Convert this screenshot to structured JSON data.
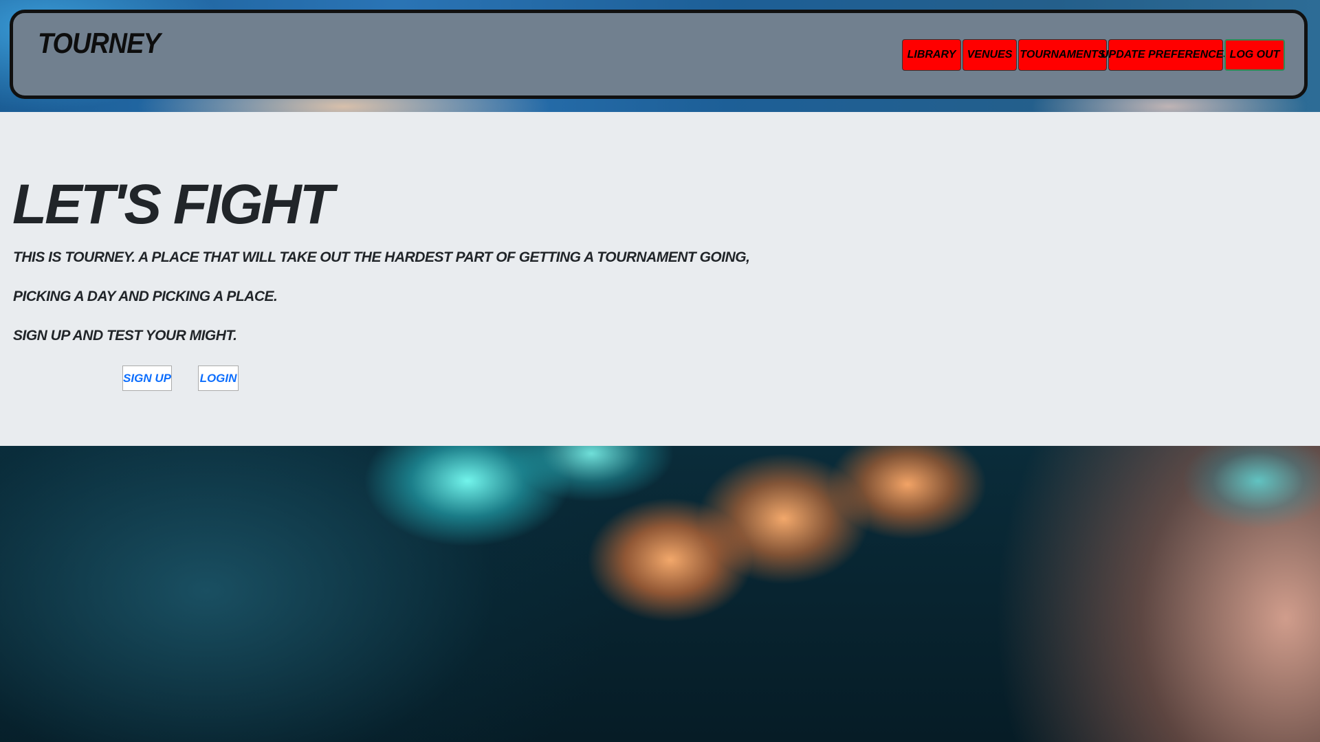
{
  "header": {
    "brand": "TOURNEY",
    "nav": [
      {
        "label": "LIBRARY"
      },
      {
        "label": "VENUES"
      },
      {
        "label": "TOURNAMENTS"
      },
      {
        "label": "UPDATE PREFERENCES"
      },
      {
        "label": "LOG OUT"
      }
    ]
  },
  "hero": {
    "title": "LET'S FIGHT",
    "lines": [
      "THIS IS TOURNEY. A PLACE THAT WILL TAKE OUT THE HARDEST PART OF GETTING A TOURNAMENT GOING,",
      "PICKING A DAY AND PICKING A PLACE.",
      "SIGN UP AND TEST YOUR MIGHT."
    ],
    "signup_label": "SIGN UP",
    "login_label": "LOGIN"
  },
  "colors": {
    "header_bg": "#71808f",
    "nav_button_bg": "#ff0000",
    "hero_bg": "#e9ecef",
    "link_blue": "#0d6efd"
  }
}
